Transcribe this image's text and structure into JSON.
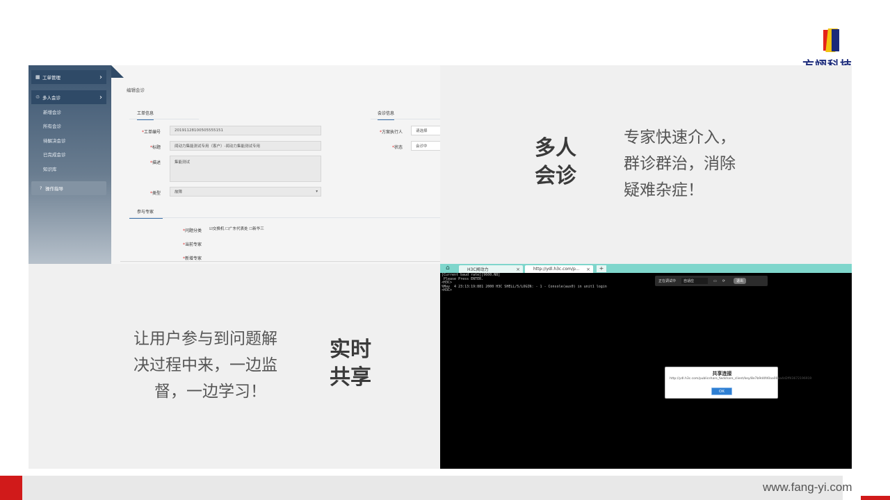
{
  "logo": {
    "text": "方翊科技"
  },
  "colors": {
    "accent": "#d11a1a",
    "brand_blue": "#1b2a7a",
    "sidebar": "#2f4a67"
  },
  "panel_tl": {
    "sidebar": {
      "workorder": "工单管理",
      "consult": "多人会诊",
      "sub_items": [
        "新增会诊",
        "所有会诊",
        "待解决会诊",
        "已完成会诊",
        "知识库"
      ],
      "guide": "操作指导"
    },
    "form": {
      "title": "编辑会诊",
      "tab_info": "工单信息",
      "tab_consult": "会诊信息",
      "tab_experts": "参与专家",
      "label_no": "工单编号",
      "value_no": "20191128100505555151",
      "label_title": "标题",
      "value_title": "闻动力集能测试专用（客户）-闻动力集能测试专用",
      "label_desc": "描述",
      "value_desc": "集能测试",
      "label_type": "类型",
      "value_type": "故障",
      "label_exec": "方案执行人",
      "value_exec": "请选择",
      "label_status": "状态",
      "value_status": "会诊中",
      "label_category": "问题分类",
      "checks": "☑交换机 ☐广东代表处 ☐新华三",
      "label_current": "当前专家",
      "label_new": "新增专家"
    }
  },
  "panel_tr": {
    "title_l1": "多人",
    "title_l2": "会诊",
    "body_l1": "专家快速介入，",
    "body_l2": "群诊群治，消除",
    "body_l3": "疑难杂症！"
  },
  "panel_bl": {
    "body_l1": "让用户参与到问题解",
    "body_l2": "决过程中来，一边监",
    "body_l3": "督，一边学习！",
    "title_l1": "实时",
    "title_l2": "共享"
  },
  "panel_br": {
    "tab1": "H3C闻动力",
    "tab2": "http://ydl.h3c.com/p...",
    "terminal": "[Current baud rate][9600.N8]\n Please Press ENTER.\n<H3C>\n%May  4 23:13:19:881 2000 H3C SHELL/5/LOGIN: - 1 - Console(aux0) in unit1 login\n<H3C>",
    "ctrl_status": "正在调试中",
    "ctrl_select": "自适应",
    "ctrl_exit": "退出",
    "dialog_title": "共享连接",
    "dialog_url": "http://ydl.h3c.com/publicshare_fwdshare_client/key/8e7b9d4fd0aa00ba4d2ff43672196919",
    "dialog_ok": "OK"
  },
  "footer": {
    "url": "www.fang-yi.com"
  }
}
